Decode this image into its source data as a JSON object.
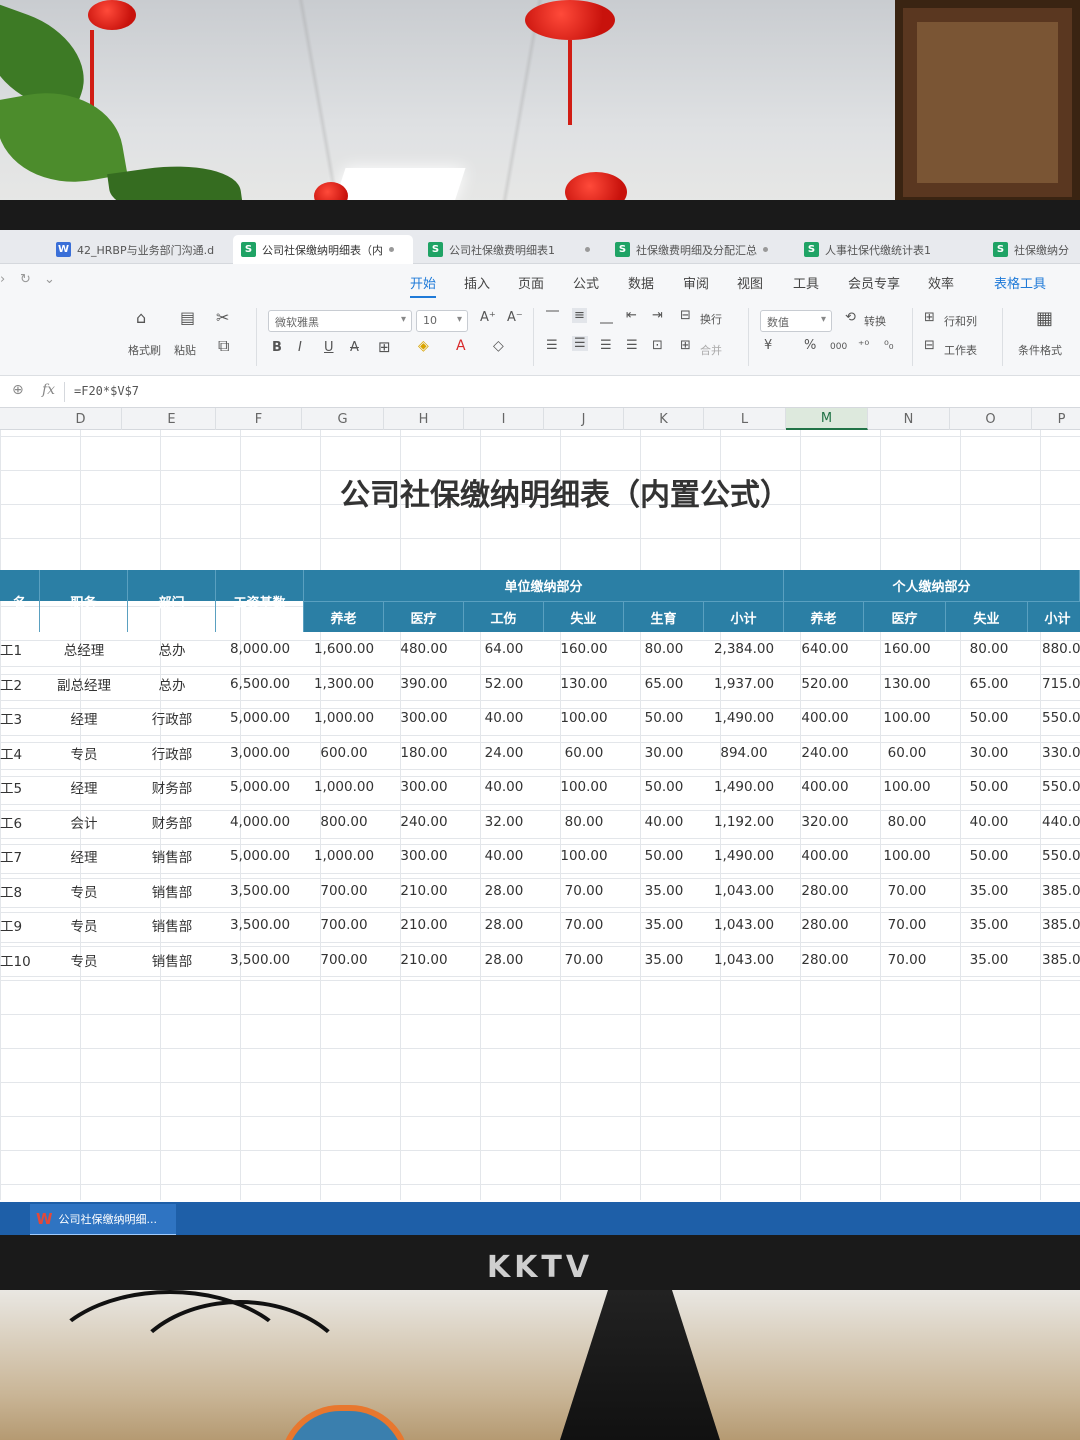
{
  "tabs": [
    {
      "type": "W",
      "label": "42_HRBP与业务部门沟通.d",
      "active": false
    },
    {
      "type": "S",
      "label": "公司社保缴纳明细表（内",
      "active": true
    },
    {
      "type": "S",
      "label": "公司社保缴费明细表1",
      "active": false
    },
    {
      "type": "S",
      "label": "社保缴费明细及分配汇总",
      "active": false
    },
    {
      "type": "S",
      "label": "人事社保代缴统计表1",
      "active": false
    },
    {
      "type": "S",
      "label": "社保缴纳分",
      "active": false
    }
  ],
  "menu": [
    "开始",
    "插入",
    "页面",
    "公式",
    "数据",
    "审阅",
    "视图",
    "工具",
    "会员专享",
    "效率",
    "表格工具"
  ],
  "ribbon": {
    "format_painter": "格式刷",
    "paste": "粘贴",
    "font_name": "微软雅黑",
    "font_size": "10",
    "wrap": "换行",
    "merge": "合并",
    "number_format": "数值",
    "convert": "转换",
    "row_col": "行和列",
    "worksheet": "工作表",
    "cond_format": "条件格式",
    "currency": "¥",
    "percent": "%",
    "thousands": "000"
  },
  "formula": {
    "fx": "fx",
    "value": "=F20*$V$7"
  },
  "columns": [
    "D",
    "E",
    "F",
    "G",
    "H",
    "I",
    "J",
    "K",
    "L",
    "M",
    "N",
    "O",
    "P"
  ],
  "selected_column": "M",
  "sheet": {
    "title": "公司社保缴纳明细表（内置公式）",
    "headers": {
      "name": "名",
      "position": "职务",
      "dept": "部门",
      "base": "工资基数",
      "unit_group": "单位缴纳部分",
      "personal_group": "个人缴纳部分",
      "unit_cols": [
        "养老",
        "医疗",
        "工伤",
        "失业",
        "生育",
        "小计"
      ],
      "personal_cols": [
        "养老",
        "医疗",
        "失业",
        "小计"
      ]
    },
    "rows": [
      {
        "name": "工1",
        "position": "总经理",
        "dept": "总办",
        "base": "8,000.00",
        "unit": [
          "1,600.00",
          "480.00",
          "64.00",
          "160.00",
          "80.00",
          "2,384.00"
        ],
        "personal": [
          "640.00",
          "160.00",
          "80.00",
          "880.0"
        ]
      },
      {
        "name": "工2",
        "position": "副总经理",
        "dept": "总办",
        "base": "6,500.00",
        "unit": [
          "1,300.00",
          "390.00",
          "52.00",
          "130.00",
          "65.00",
          "1,937.00"
        ],
        "personal": [
          "520.00",
          "130.00",
          "65.00",
          "715.0"
        ]
      },
      {
        "name": "工3",
        "position": "经理",
        "dept": "行政部",
        "base": "5,000.00",
        "unit": [
          "1,000.00",
          "300.00",
          "40.00",
          "100.00",
          "50.00",
          "1,490.00"
        ],
        "personal": [
          "400.00",
          "100.00",
          "50.00",
          "550.0"
        ]
      },
      {
        "name": "工4",
        "position": "专员",
        "dept": "行政部",
        "base": "3,000.00",
        "unit": [
          "600.00",
          "180.00",
          "24.00",
          "60.00",
          "30.00",
          "894.00"
        ],
        "personal": [
          "240.00",
          "60.00",
          "30.00",
          "330.0"
        ]
      },
      {
        "name": "工5",
        "position": "经理",
        "dept": "财务部",
        "base": "5,000.00",
        "unit": [
          "1,000.00",
          "300.00",
          "40.00",
          "100.00",
          "50.00",
          "1,490.00"
        ],
        "personal": [
          "400.00",
          "100.00",
          "50.00",
          "550.0"
        ]
      },
      {
        "name": "工6",
        "position": "会计",
        "dept": "财务部",
        "base": "4,000.00",
        "unit": [
          "800.00",
          "240.00",
          "32.00",
          "80.00",
          "40.00",
          "1,192.00"
        ],
        "personal": [
          "320.00",
          "80.00",
          "40.00",
          "440.0"
        ]
      },
      {
        "name": "工7",
        "position": "经理",
        "dept": "销售部",
        "base": "5,000.00",
        "unit": [
          "1,000.00",
          "300.00",
          "40.00",
          "100.00",
          "50.00",
          "1,490.00"
        ],
        "personal": [
          "400.00",
          "100.00",
          "50.00",
          "550.0"
        ]
      },
      {
        "name": "工8",
        "position": "专员",
        "dept": "销售部",
        "base": "3,500.00",
        "unit": [
          "700.00",
          "210.00",
          "28.00",
          "70.00",
          "35.00",
          "1,043.00"
        ],
        "personal": [
          "280.00",
          "70.00",
          "35.00",
          "385.0"
        ]
      },
      {
        "name": "工9",
        "position": "专员",
        "dept": "销售部",
        "base": "3,500.00",
        "unit": [
          "700.00",
          "210.00",
          "28.00",
          "70.00",
          "35.00",
          "1,043.00"
        ],
        "personal": [
          "280.00",
          "70.00",
          "35.00",
          "385.0"
        ]
      },
      {
        "name": "工10",
        "position": "专员",
        "dept": "销售部",
        "base": "3,500.00",
        "unit": [
          "700.00",
          "210.00",
          "28.00",
          "70.00",
          "35.00",
          "1,043.00"
        ],
        "personal": [
          "280.00",
          "70.00",
          "35.00",
          "385.0"
        ]
      }
    ]
  },
  "taskbar": {
    "app_label": "公司社保缴纳明细..."
  },
  "monitor_brand": "KKTV",
  "colors": {
    "header_blue": "#2b7fa5",
    "accent_blue": "#1f7ad8",
    "select_green": "#217346",
    "taskbar_blue": "#1e5fa8"
  }
}
